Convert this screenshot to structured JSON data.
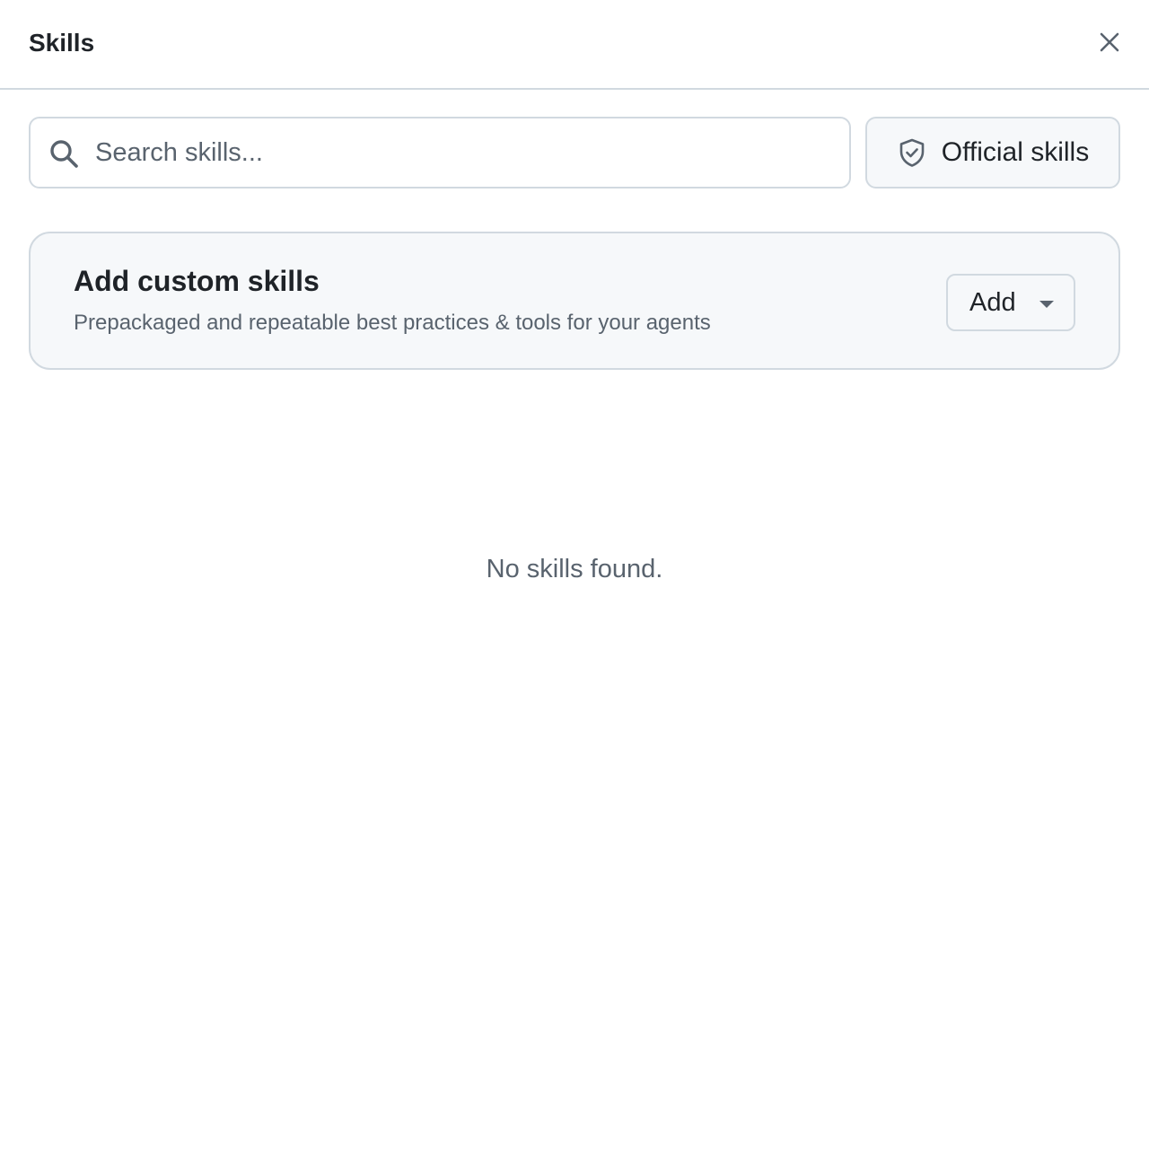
{
  "dialog": {
    "title": "Skills",
    "close_icon": "close-icon"
  },
  "search": {
    "placeholder": "Search skills...",
    "value": "",
    "icon": "search-icon"
  },
  "official_filter": {
    "label": "Official skills",
    "icon": "shield-check-icon"
  },
  "custom_card": {
    "title": "Add custom skills",
    "description": "Prepackaged and repeatable best practices & tools for your agents",
    "add_button_label": "Add",
    "add_button_icon": "chevron-down-icon"
  },
  "empty_state": {
    "message": "No skills found."
  },
  "colors": {
    "text_primary": "#1f2328",
    "text_muted": "#59636e",
    "border": "#d1d9e0",
    "surface_subtle": "#f6f8fa"
  }
}
